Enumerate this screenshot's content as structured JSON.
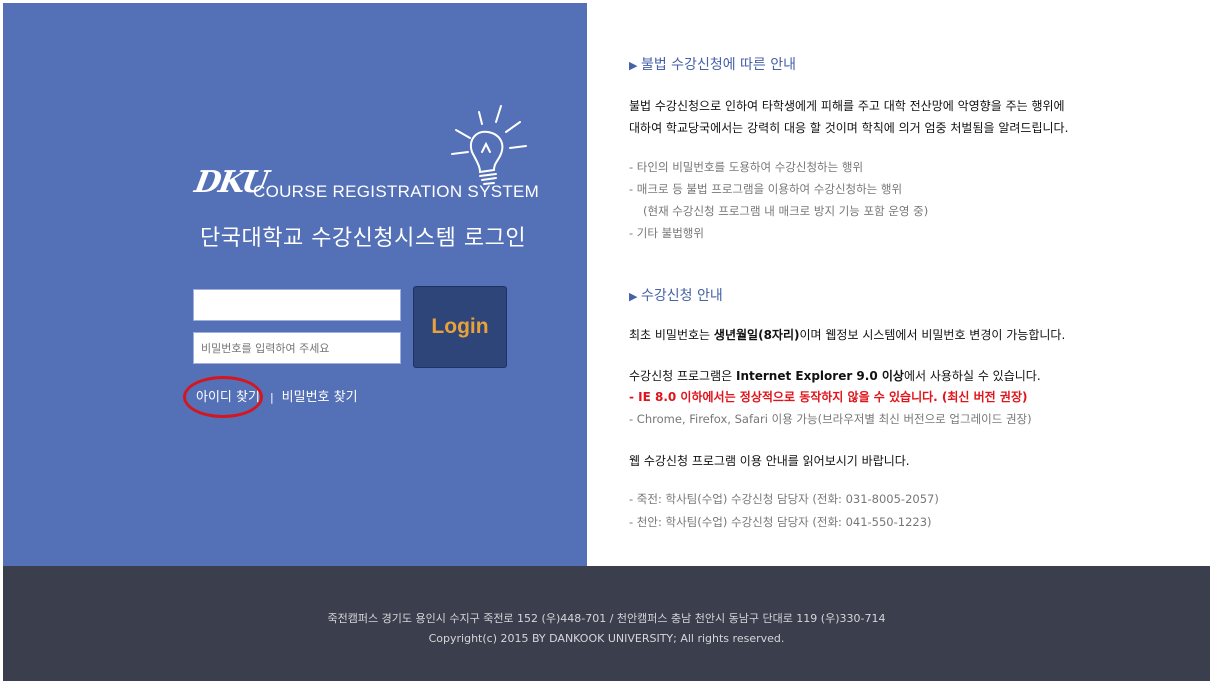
{
  "login": {
    "logo_mark": "DKU",
    "logo_text": "COURSE REGISTRATION SYSTEM",
    "title": "단국대학교 수강신청시스템 로그인",
    "id_value": "",
    "pw_placeholder": "비밀번호를 입력하여 주세요",
    "login_button": "Login",
    "find_id": "아이디 찾기",
    "separator": "|",
    "find_pw": "비밀번호 찾기"
  },
  "notice": {
    "illegal_title": "불법 수강신청에 따른 안내",
    "illegal_line1": "불법 수강신청으로 인하여 타학생에게 피해를 주고 대학 전산망에 악영향을 주는 행위에",
    "illegal_line2": "대하여 학교당국에서는 강력히 대응 할 것이며 학칙에 의거 엄중 처벌됨을 알려드립니다.",
    "illegal_items": [
      "- 타인의 비밀번호를 도용하여 수강신청하는 행위",
      "- 매크로 등 불법 프로그램을 이용하여 수강신청하는 행위",
      "(현재 수강신청 프로그램 내 매크로 방지 기능 포함 운영 중)",
      "- 기타 불법행위"
    ],
    "guide_title": "수강신청 안내",
    "pw_info_pre": "최초 비밀번호는 ",
    "pw_info_bold": "생년월일(8자리)",
    "pw_info_post": "이며 웹정보 시스템에서 비밀번호 변경이 가능합니다.",
    "ie_pre": "수강신청 프로그램은 ",
    "ie_bold": "Internet Explorer 9.0 이상",
    "ie_post": "에서 사용하실 수 있습니다.",
    "ie_warning": "- IE 8.0 이하에서는 정상적으로 동작하지 않을 수 있습니다. (최신 버전 권장)",
    "browsers": "- Chrome, Firefox, Safari 이용 가능(브라우저별 최신 버전으로 업그레이드 권장)",
    "web_guide": "웹 수강신청 프로그램 이용 안내를 읽어보시기 바랍니다.",
    "contact1": "- 죽전: 학사팀(수업) 수강신청 담당자 (전화: 031-8005-2057)",
    "contact2": "- 천안: 학사팀(수업) 수강신청 담당자 (전화: 041-550-1223)"
  },
  "footer": {
    "address": "죽전캠퍼스 경기도 용인시 수지구 죽전로 152 (우)448-701 / 천안캠퍼스 충남 천안시 동남구 단대로 119 (우)330-714",
    "copyright": "Copyright(c) 2015 BY DANKOOK UNIVERSITY; All rights reserved."
  },
  "colors": {
    "left_panel": "#5470b7",
    "footer": "#3b3e4c",
    "login_button": "#2d4579",
    "login_text": "#e9a23a",
    "section_title": "#4661a8",
    "warning": "#e0141a",
    "highlight_circle": "#d4161f"
  },
  "icons": {
    "logo": "lightbulb-icon"
  }
}
